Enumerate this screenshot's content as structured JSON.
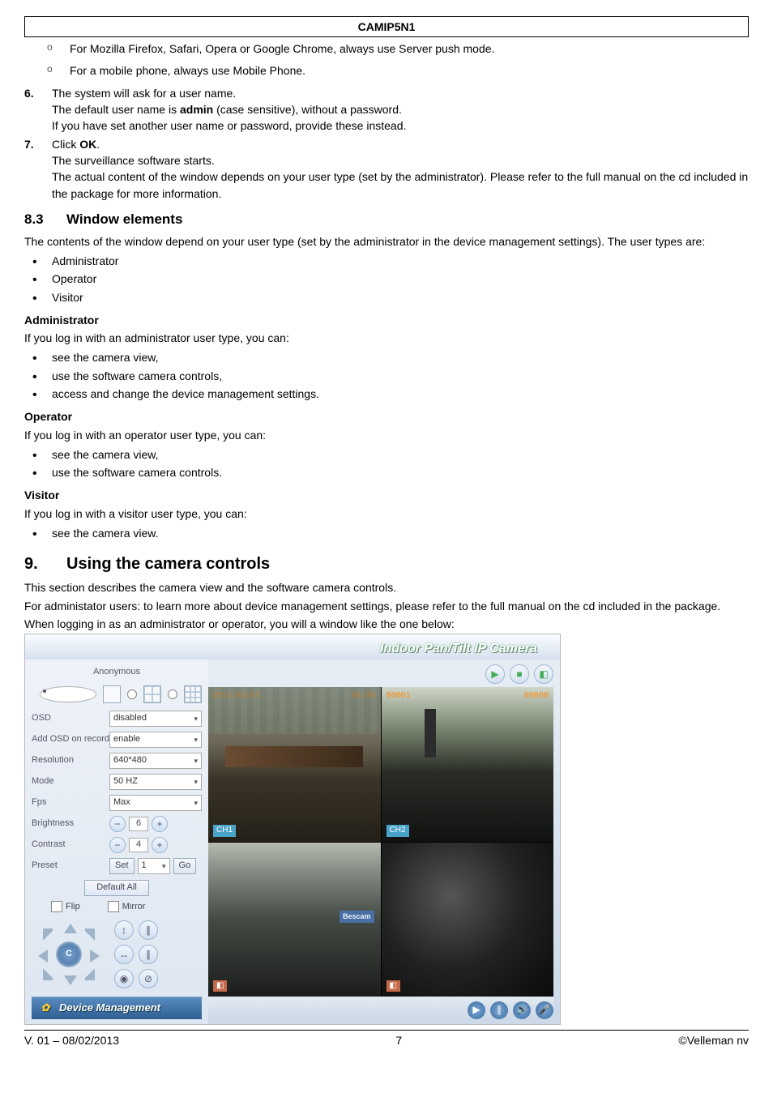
{
  "header": {
    "title": "CAMIP5N1"
  },
  "intro_sub": [
    "For Mozilla Firefox, Safari, Opera or Google Chrome, always use Server push mode.",
    "For a mobile phone, always use Mobile Phone."
  ],
  "steps": {
    "s6": {
      "num": "6.",
      "l1": "The system will ask for a user name.",
      "l2a": "The default user name is ",
      "l2b": "admin",
      "l2c": " (case sensitive), without a password.",
      "l3": "If you have set another user name or password, provide these instead."
    },
    "s7": {
      "num": "7.",
      "l1a": "Click ",
      "l1b": "OK",
      "l1c": ".",
      "l2": "The surveillance software starts.",
      "l3": "The actual content of the window depends on your user type (set by the administrator). Please refer to the full manual on the cd included in the package for more information."
    }
  },
  "sec83": {
    "num": "8.3",
    "title": "Window elements",
    "intro": "The contents of the window depend on your user type (set by the administrator in the device management settings). The user types are:",
    "types": [
      "Administrator",
      "Operator",
      "Visitor"
    ],
    "admin": {
      "head": "Administrator",
      "intro": "If you log in with an administrator user type, you can:",
      "items": [
        "see the camera view,",
        "use the software camera controls,",
        "access and change the device management settings."
      ]
    },
    "oper": {
      "head": "Operator",
      "intro": "If you log in with an operator user type, you can:",
      "items": [
        "see the camera view,",
        "use the software camera controls."
      ]
    },
    "vis": {
      "head": "Visitor",
      "intro": "If you log in with a visitor user type, you can:",
      "items": [
        "see the camera view."
      ]
    }
  },
  "sec9": {
    "num": "9.",
    "title": "Using the camera controls",
    "p1": "This section describes the camera view and the software camera controls.",
    "p2": "For administator users: to learn more about device management settings, please refer to the full manual on the cd included in the package.",
    "p3": "When logging in as an administrator or operator, you will a window like the one below:"
  },
  "app": {
    "title": "Indoor Pan/Tilt IP Camera",
    "anon": "Anonymous",
    "controls": {
      "osd": {
        "label": "OSD",
        "value": "disabled"
      },
      "addosd": {
        "label": "Add OSD on record",
        "value": "enable"
      },
      "res": {
        "label": "Resolution",
        "value": "640*480"
      },
      "mode": {
        "label": "Mode",
        "value": "50 HZ"
      },
      "fps": {
        "label": "Fps",
        "value": "Max"
      },
      "bri": {
        "label": "Brightness",
        "value": "6"
      },
      "con": {
        "label": "Contrast",
        "value": "4"
      },
      "preset": {
        "label": "Preset",
        "set": "Set",
        "value": "1",
        "go": "Go"
      },
      "defall": "Default All",
      "flip": "Flip",
      "mirror": "Mirror",
      "center": "C"
    },
    "dm": "Device Management",
    "feeds": {
      "ch1": "CH1",
      "ch2": "CH2",
      "ts1a": "2013/02/05",
      "ts1b": "08:08",
      "ts2a": "00001",
      "ts2b": "00000",
      "sign": "Bescam"
    }
  },
  "footer": {
    "left": "V. 01 – 08/02/2013",
    "center": "7",
    "right": "©Velleman nv"
  }
}
